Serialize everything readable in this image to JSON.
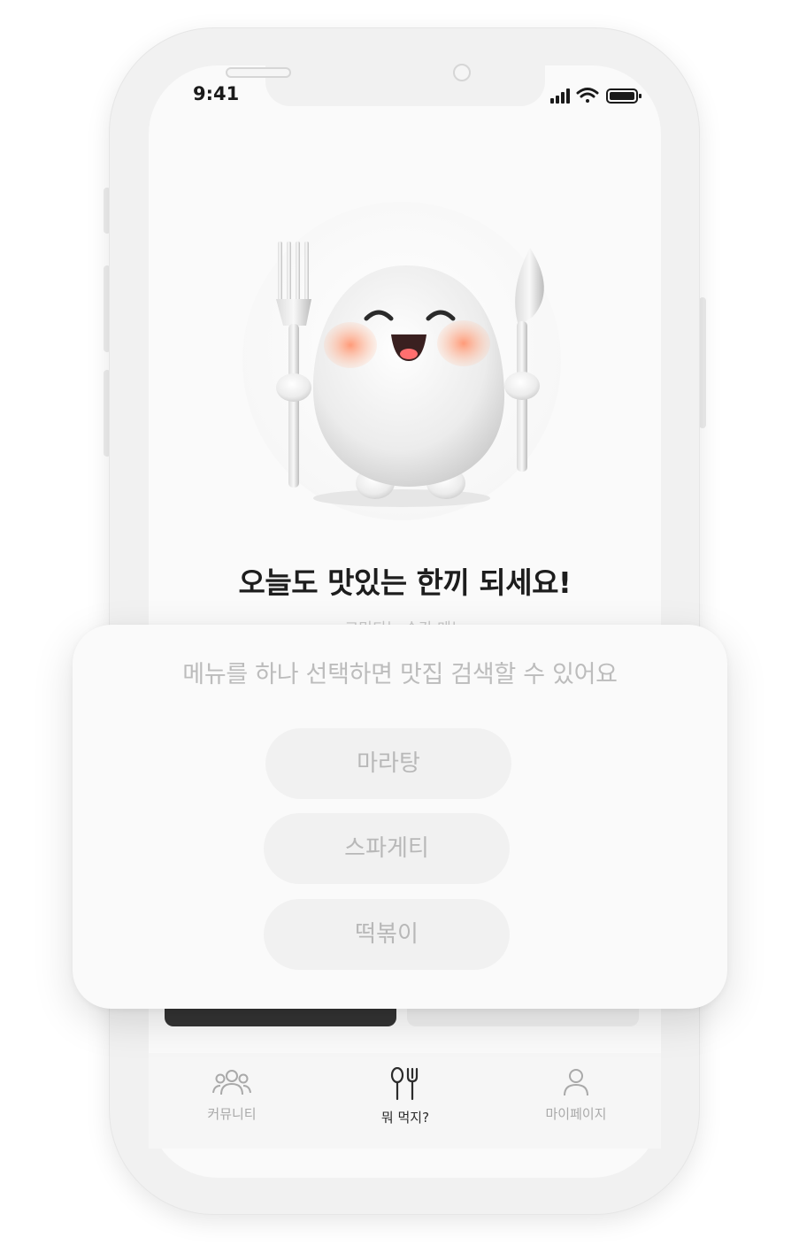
{
  "status_bar": {
    "time": "9:41"
  },
  "hero": {
    "title": "오늘도 맛있는 한끼 되세요!",
    "subtitle": "고민되는 순간 메뉴"
  },
  "sheet": {
    "prompt": "메뉴를 하나 선택하면 맛집 검색할 수 있어요",
    "options": [
      "마라탕",
      "스파게티",
      "떡볶이"
    ]
  },
  "tabs": [
    {
      "label": "커뮤니티",
      "icon": "users-icon",
      "active": false
    },
    {
      "label": "뭐 먹지?",
      "icon": "fork-spoon-icon",
      "active": true
    },
    {
      "label": "마이페이지",
      "icon": "person-icon",
      "active": false
    }
  ],
  "colors": {
    "primary_dark": "#333333",
    "muted_text": "#bcbcbc",
    "pill_bg": "#f1f1f1",
    "active_tab": "#2c2c2c",
    "inactive_tab": "#a9a9a9"
  }
}
